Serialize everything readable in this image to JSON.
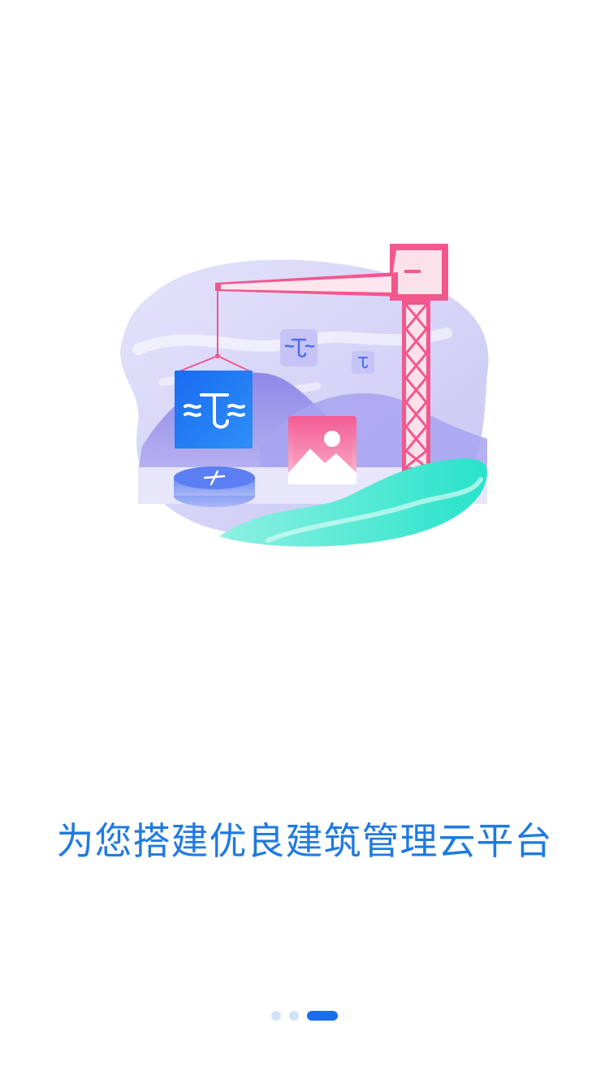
{
  "onboarding": {
    "slogan": "为您搭建优良建筑管理云平台",
    "illustration": {
      "icon": "construction-crane-illustration"
    },
    "pager": {
      "total_pages": 3,
      "current_page": 3,
      "dot_color": "#cfe3fb",
      "active_dot_color": "#1a6cf0"
    }
  },
  "colors": {
    "background": "#ffffff",
    "slogan_text": "#1f7ae0",
    "crane": "#f2578e",
    "logo_blue": "#1a73f5",
    "water": "#3de3d0"
  }
}
